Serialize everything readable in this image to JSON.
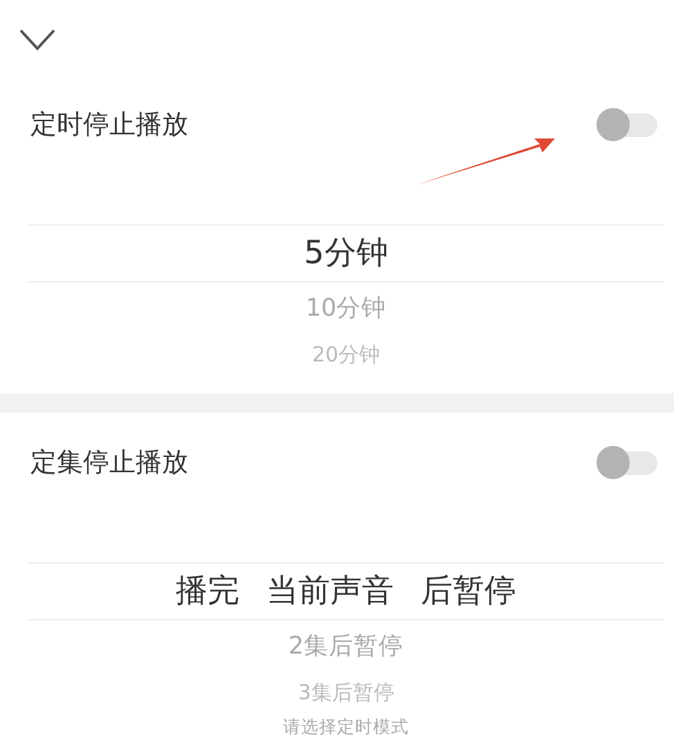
{
  "sections": [
    {
      "title": "定时停止播放",
      "on": false,
      "options": [
        {
          "label": "5分钟",
          "selected": true
        },
        {
          "label": "10分钟",
          "selected": false
        },
        {
          "label": "20分钟",
          "selected": false
        }
      ]
    },
    {
      "title": "定集停止播放",
      "on": false,
      "options": [
        {
          "label": "播完 当前声音 后暂停",
          "selected": true
        },
        {
          "label": "2集后暂停",
          "selected": false
        },
        {
          "label": "3集后暂停",
          "selected": false
        },
        {
          "label": "请选择定时模式",
          "selected": false
        }
      ]
    }
  ]
}
